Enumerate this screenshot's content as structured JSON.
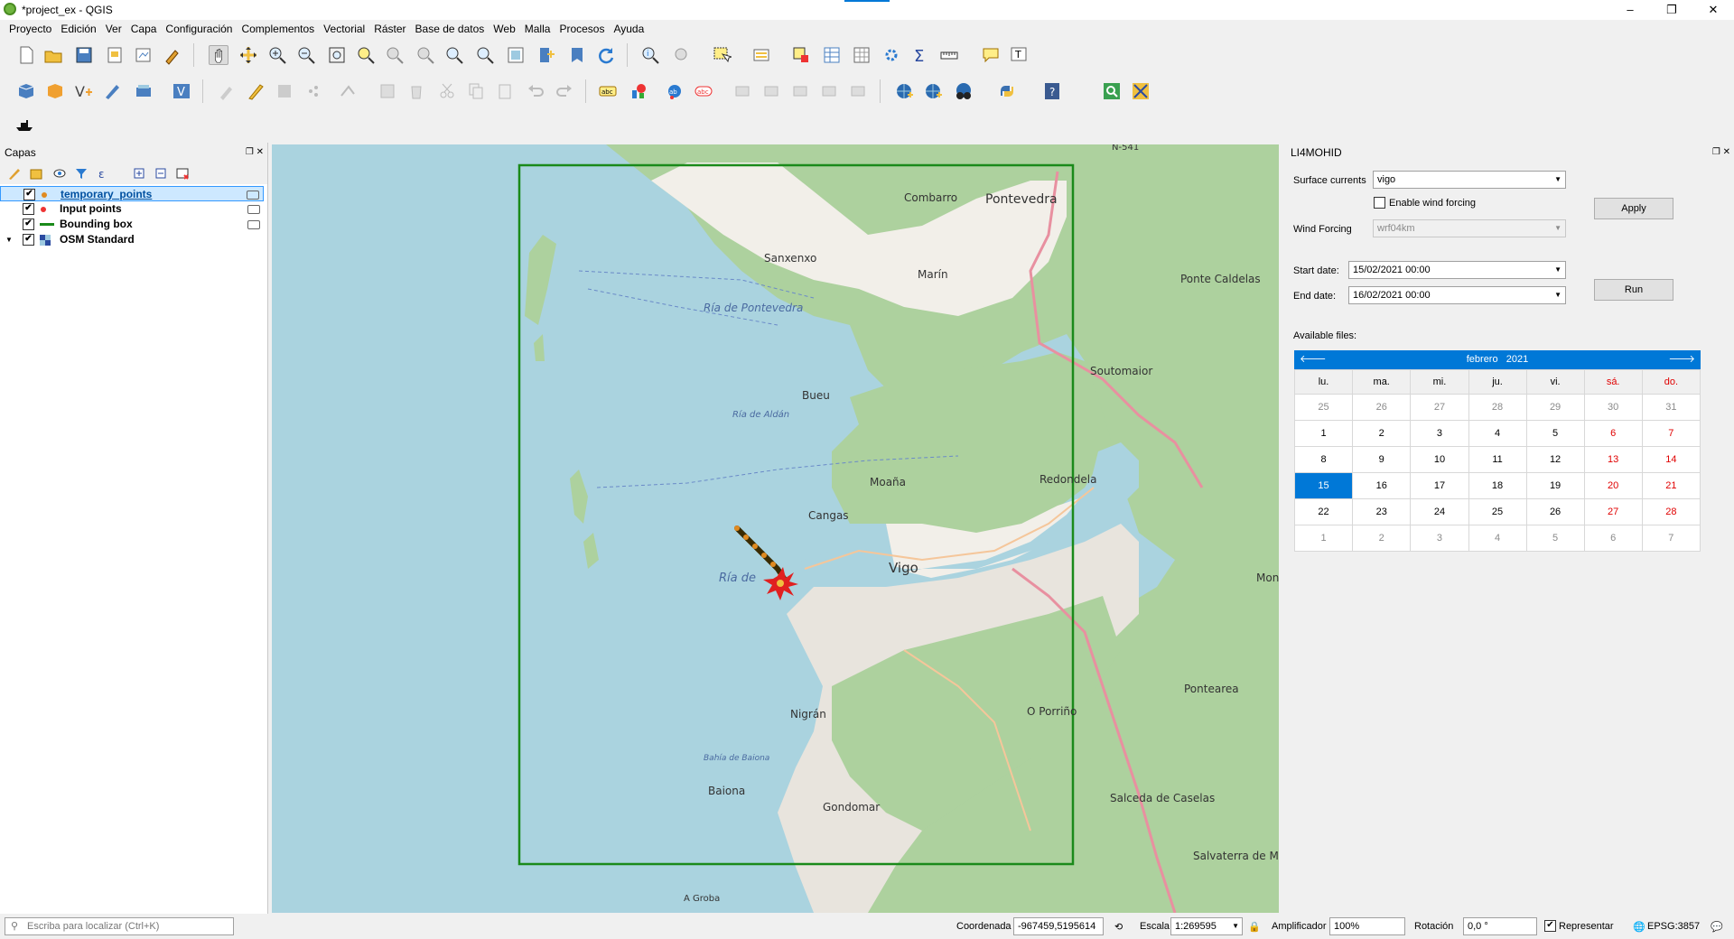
{
  "window": {
    "title": "*project_ex - QGIS",
    "minimize": "–",
    "maximize": "❐",
    "close": "✕"
  },
  "menu": [
    "Proyecto",
    "Edición",
    "Ver",
    "Capa",
    "Configuración",
    "Complementos",
    "Vectorial",
    "Ráster",
    "Base de datos",
    "Web",
    "Malla",
    "Procesos",
    "Ayuda"
  ],
  "layers_panel": {
    "title": "Capas",
    "layers": [
      {
        "name": "temporary_points",
        "checked": true,
        "symbol": "point-orange"
      },
      {
        "name": "Input points",
        "checked": true,
        "symbol": "point-red"
      },
      {
        "name": "Bounding box",
        "checked": true,
        "symbol": "line-green"
      },
      {
        "name": "OSM Standard",
        "checked": true,
        "symbol": "raster-tile"
      }
    ]
  },
  "map": {
    "labels": [
      "Pontevedra",
      "Combarro",
      "Sanxenxo",
      "Marín",
      "Ría de Pontevedra",
      "Ponte Caldelas",
      "Soutomaior",
      "Bueu",
      "Ría de Aldán",
      "Moaña",
      "Cangas",
      "Redondela",
      "Vigo",
      "Ría de",
      "Pontevedra",
      "Nigrán",
      "Baiona",
      "Bahía de Baiona",
      "Gondomar",
      "O Porriño",
      "Pontearea",
      "Salceda de Caselas",
      "Salvaterra de Miño",
      "A Groba",
      "N-541",
      "Mon"
    ],
    "colors": {
      "sea": "#aad3df",
      "land": "#f2efe9",
      "forest": "#add19e",
      "bbox": "#1a8a1a",
      "track": "#7a4a00"
    }
  },
  "plugin": {
    "title": "LI4MOHID",
    "surface_currents_label": "Surface currents",
    "surface_currents_value": "vigo",
    "wind_checkbox_label": "Enable wind forcing",
    "wind_forcing_label": "Wind Forcing",
    "wind_forcing_value": "wrf04km",
    "start_label": "Start date:",
    "start_value": "15/02/2021 00:00",
    "end_label": "End date:",
    "end_value": "16/02/2021  00:00",
    "apply": "Apply",
    "run": "Run",
    "available_files": "Available files:",
    "calendar": {
      "month": "febrero",
      "year": "2021",
      "weekdays": [
        "lu.",
        "ma.",
        "mi.",
        "ju.",
        "vi.",
        "sá.",
        "do."
      ],
      "weeks": [
        [
          "25",
          "26",
          "27",
          "28",
          "29",
          "30",
          "31"
        ],
        [
          "1",
          "2",
          "3",
          "4",
          "5",
          "6",
          "7"
        ],
        [
          "8",
          "9",
          "10",
          "11",
          "12",
          "13",
          "14"
        ],
        [
          "15",
          "16",
          "17",
          "18",
          "19",
          "20",
          "21"
        ],
        [
          "22",
          "23",
          "24",
          "25",
          "26",
          "27",
          "28"
        ],
        [
          "1",
          "2",
          "3",
          "4",
          "5",
          "6",
          "7"
        ]
      ],
      "selected": "15"
    }
  },
  "status": {
    "locator_placeholder": "Escriba para localizar (Ctrl+K)",
    "coord_label": "Coordenada",
    "coord_value": "-967459,5195614",
    "scale_label": "Escala",
    "scale_value": "1:269595",
    "magnifier_label": "Amplificador",
    "magnifier_value": "100%",
    "rotation_label": "Rotación",
    "rotation_value": "0,0 °",
    "render_label": "Representar",
    "crs": "EPSG:3857"
  }
}
